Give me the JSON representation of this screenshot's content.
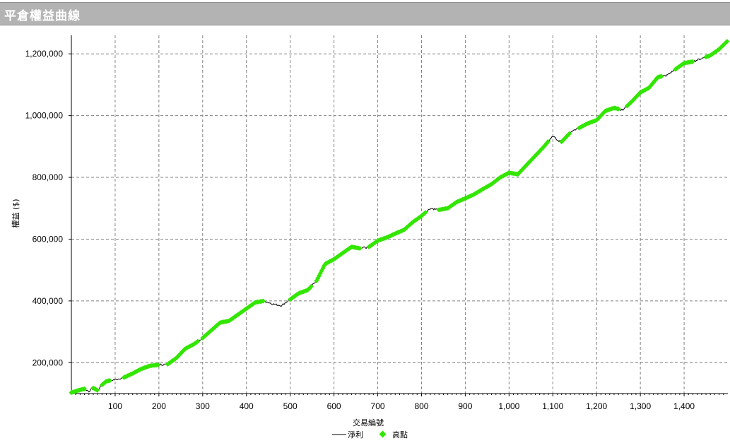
{
  "window": {
    "title": "平倉權益曲線"
  },
  "colors": {
    "line": "#000000",
    "highs": "#33e600",
    "grid": "#808080",
    "header": "#b3b3b3"
  },
  "chart_data": {
    "type": "line",
    "title": "平倉權益曲線",
    "xlabel": "交易編號",
    "ylabel": "權益 ($)",
    "xlim": [
      0,
      1500
    ],
    "ylim": [
      100000,
      1260000
    ],
    "x_ticks": [
      100,
      200,
      300,
      400,
      500,
      600,
      700,
      800,
      900,
      1000,
      1100,
      1200,
      1300,
      1400
    ],
    "x_tick_labels": [
      "100",
      "200",
      "300",
      "400",
      "500",
      "600",
      "700",
      "800",
      "900",
      "1,000",
      "1,100",
      "1,200",
      "1,300",
      "1,400"
    ],
    "y_ticks": [
      200000,
      400000,
      600000,
      800000,
      1000000,
      1200000
    ],
    "y_tick_labels": [
      "200,000",
      "400,000",
      "600,000",
      "800,000",
      "1,000,000",
      "1,200,000"
    ],
    "grid": true,
    "legend": {
      "placement": "bottom-center",
      "entries": [
        "淨利",
        "高點"
      ]
    },
    "series": [
      {
        "name": "淨利",
        "style": "line",
        "x": [
          0,
          20,
          30,
          40,
          50,
          60,
          70,
          80,
          100,
          120,
          140,
          160,
          180,
          200,
          220,
          240,
          260,
          280,
          300,
          320,
          340,
          360,
          380,
          400,
          420,
          440,
          460,
          480,
          500,
          520,
          540,
          560,
          580,
          600,
          620,
          640,
          660,
          680,
          700,
          720,
          740,
          760,
          780,
          800,
          820,
          840,
          860,
          880,
          900,
          920,
          940,
          960,
          980,
          1000,
          1020,
          1040,
          1060,
          1080,
          1100,
          1110,
          1120,
          1140,
          1160,
          1180,
          1200,
          1220,
          1240,
          1260,
          1280,
          1300,
          1320,
          1340,
          1360,
          1380,
          1400,
          1420,
          1440,
          1460,
          1480,
          1500
        ],
        "y": [
          103000,
          112000,
          115000,
          107000,
          118000,
          110000,
          128000,
          140000,
          145000,
          152000,
          165000,
          180000,
          190000,
          193000,
          195000,
          215000,
          245000,
          260000,
          280000,
          305000,
          330000,
          335000,
          355000,
          375000,
          395000,
          400000,
          390000,
          385000,
          405000,
          425000,
          435000,
          465000,
          520000,
          535000,
          555000,
          575000,
          570000,
          575000,
          595000,
          605000,
          618000,
          630000,
          655000,
          675000,
          700000,
          695000,
          700000,
          720000,
          732000,
          745000,
          762000,
          778000,
          800000,
          815000,
          810000,
          840000,
          870000,
          900000,
          935000,
          920000,
          915000,
          945000,
          960000,
          975000,
          985000,
          1015000,
          1025000,
          1018000,
          1045000,
          1075000,
          1090000,
          1125000,
          1130000,
          1150000,
          1170000,
          1175000,
          1185000,
          1195000,
          1215000,
          1243000
        ]
      },
      {
        "name": "高點",
        "style": "markers",
        "segments": [
          [
            0,
            30
          ],
          [
            50,
            60
          ],
          [
            70,
            90
          ],
          [
            120,
            200
          ],
          [
            220,
            290
          ],
          [
            300,
            440
          ],
          [
            500,
            550
          ],
          [
            560,
            660
          ],
          [
            680,
            810
          ],
          [
            840,
            1090
          ],
          [
            1120,
            1140
          ],
          [
            1160,
            1250
          ],
          [
            1270,
            1350
          ],
          [
            1380,
            1420
          ],
          [
            1450,
            1500
          ]
        ]
      }
    ]
  }
}
